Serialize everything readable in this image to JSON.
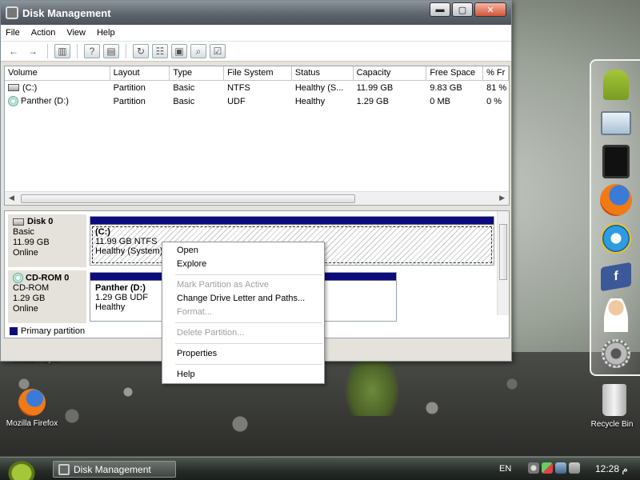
{
  "window": {
    "title": "Disk Management",
    "controls": {
      "minimize": "▬",
      "maximize": "▢",
      "close": "✕"
    }
  },
  "menu": [
    "File",
    "Action",
    "View",
    "Help"
  ],
  "toolbar": {
    "icons": [
      "back-arrow-icon",
      "forward-arrow-icon",
      "show-hide-tree-icon",
      "help-icon",
      "properties-panel-icon",
      "refresh-icon",
      "properties-icon",
      "open-folder-icon",
      "search-icon",
      "rescan-disks-icon"
    ]
  },
  "volume_list": {
    "columns": [
      "Volume",
      "Layout",
      "Type",
      "File System",
      "Status",
      "Capacity",
      "Free Space",
      "% Fr"
    ],
    "rows": [
      {
        "volume": "(C:)",
        "layout": "Partition",
        "type": "Basic",
        "fs": "NTFS",
        "status": "Healthy (S...",
        "capacity": "11.99 GB",
        "free": "9.83 GB",
        "pct": "81 %"
      },
      {
        "volume": "Panther  (D:)",
        "layout": "Partition",
        "type": "Basic",
        "fs": "UDF",
        "status": "Healthy",
        "capacity": "1.29 GB",
        "free": "0 MB",
        "pct": "0 %"
      }
    ]
  },
  "disks": {
    "disk0": {
      "name": "Disk 0",
      "type": "Basic",
      "size": "11.99 GB",
      "state": "Online",
      "partition": {
        "label": "(C:)",
        "size_fs": "11.99 GB NTFS",
        "status": "Healthy (System)"
      }
    },
    "cdrom0": {
      "name": "CD-ROM 0",
      "type": "CD-ROM",
      "size": "1.29 GB",
      "state": "Online",
      "partition": {
        "label": "Panther   (D:)",
        "size_fs": "1.29 GB UDF",
        "status": "Healthy"
      }
    }
  },
  "legend": {
    "primary": "Primary partition",
    "color": "#0b0b7e"
  },
  "context_menu": {
    "open": "Open",
    "explore": "Explore",
    "mark_active": "Mark Partition as Active",
    "change_letter": "Change Drive Letter and Paths...",
    "format": "Format...",
    "delete": "Delete Partition...",
    "properties": "Properties",
    "help": "Help"
  },
  "desktop": {
    "firefox_label": "Mozilla Firefox",
    "media_label": "Media Player",
    "recycle_label": "Recycle Bin"
  },
  "dock": [
    "android-icon",
    "network-monitor-icon",
    "tablet-icon",
    "firefox-icon",
    "internet-explorer-icon",
    "facebook-icon",
    "support-agent-icon",
    "settings-gear-icon",
    "recycle-bin-icon"
  ],
  "taskbar": {
    "task_label": "Disk Management",
    "language": "EN",
    "clock": "12:28 م"
  }
}
